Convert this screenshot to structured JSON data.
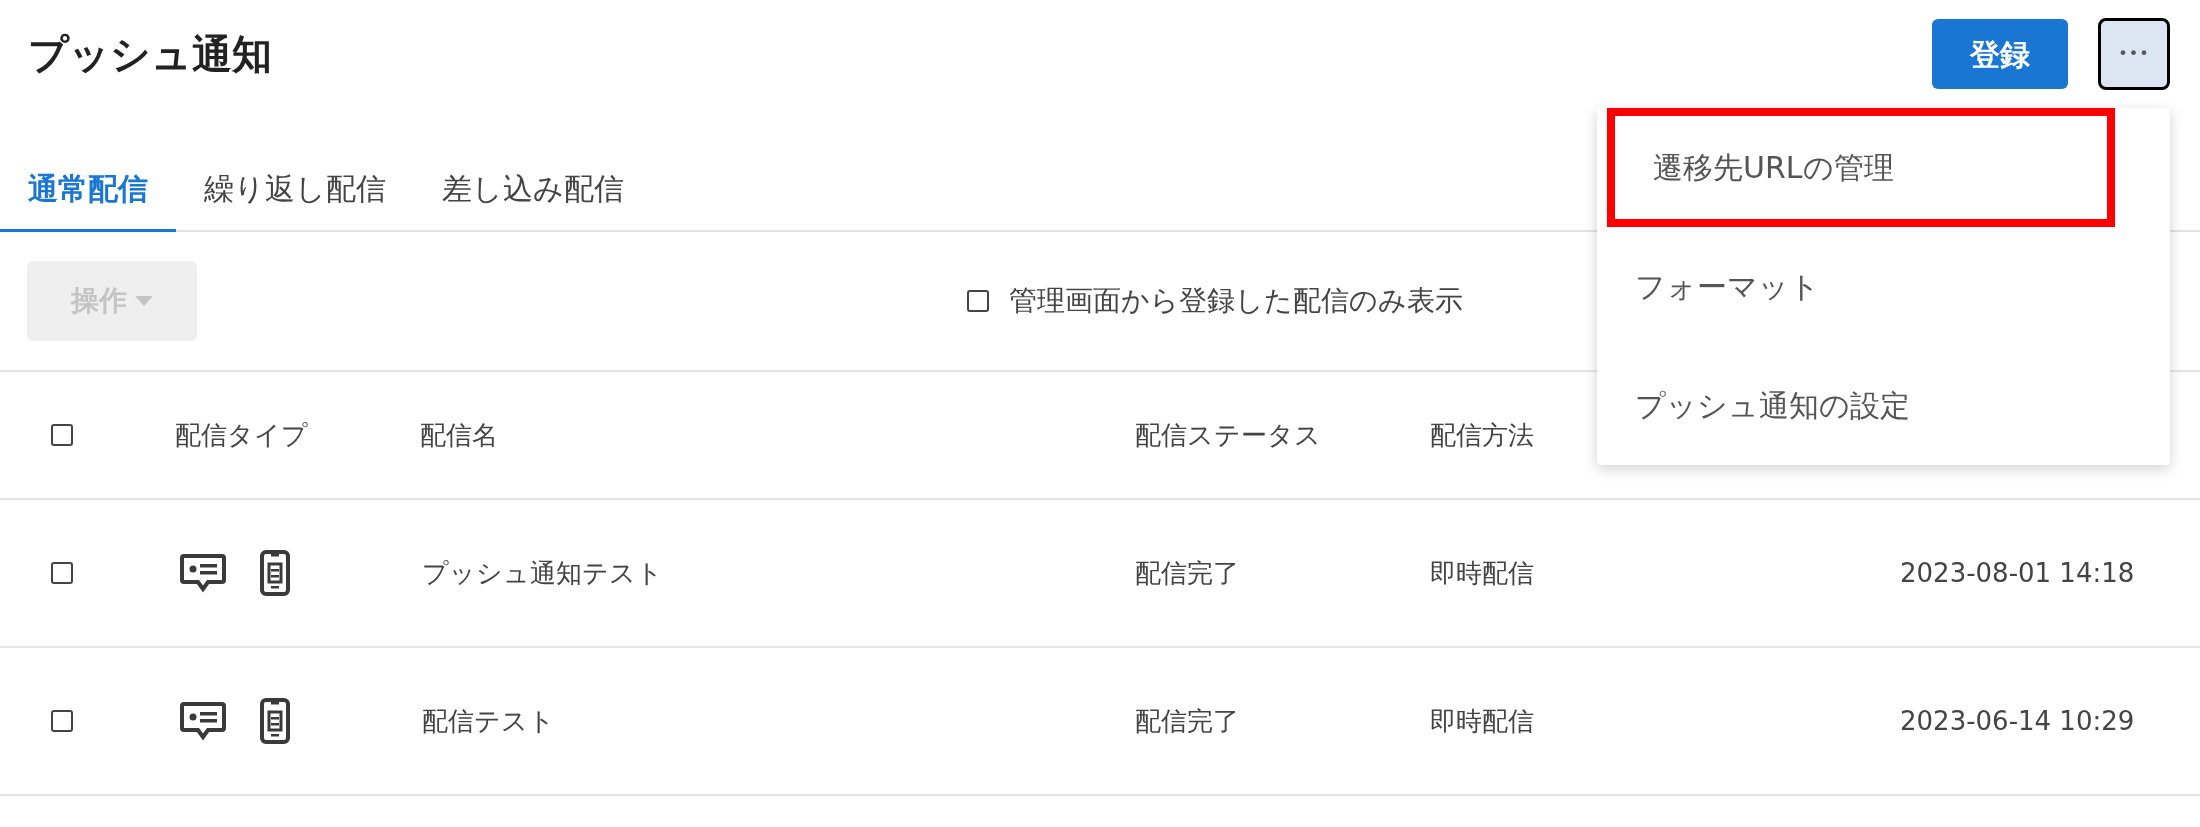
{
  "page_title": "プッシュ通知",
  "header_buttons": {
    "register": "登録",
    "more": "•••"
  },
  "tabs": [
    {
      "label": "通常配信",
      "selected": true
    },
    {
      "label": "繰り返し配信",
      "selected": false
    },
    {
      "label": "差し込み配信",
      "selected": false
    }
  ],
  "toolbar": {
    "actions_button": {
      "label": "操作",
      "disabled": true
    },
    "filter": {
      "label": "管理画面から登録した配信のみ表示",
      "checked": false
    }
  },
  "table": {
    "select_all_checked": false,
    "columns": [
      "配信タイプ",
      "配信名",
      "配信ステータス",
      "配信方法"
    ],
    "rows": [
      {
        "checked": false,
        "name": "プッシュ通知テスト",
        "status": "配信完了",
        "method": "即時配信",
        "date": "2023-08-01 14:18"
      },
      {
        "checked": false,
        "name": "配信テスト",
        "status": "配信完了",
        "method": "即時配信",
        "date": "2023-06-14 10:29"
      }
    ]
  },
  "menu": {
    "items": [
      {
        "label": "遷移先URLの管理",
        "highlighted": true
      },
      {
        "label": "フォーマット",
        "highlighted": false
      },
      {
        "label": "プッシュ通知の設定",
        "highlighted": false
      }
    ]
  }
}
